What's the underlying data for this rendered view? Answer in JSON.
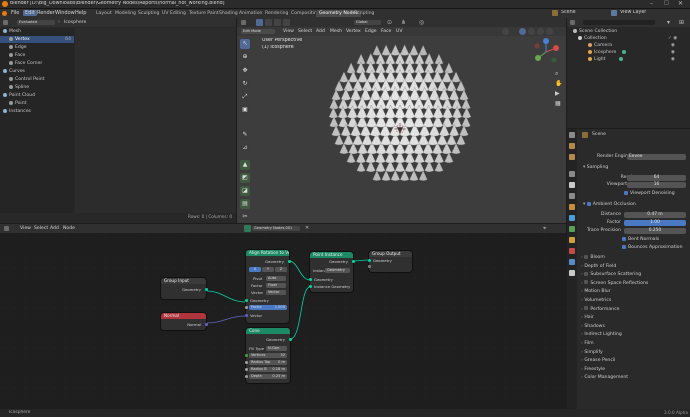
{
  "window": {
    "title": "Blender [D:\\Big_Downloads\\Blender\\Geometry Nodes\\Reports\\normal_not_working.blend]"
  },
  "menu": {
    "items": [
      "File",
      "Edit",
      "Render",
      "Window",
      "Help"
    ]
  },
  "workspaces": [
    "Layout",
    "Modeling",
    "Sculpting",
    "UV Editing",
    "Texture Paint",
    "Shading",
    "Animation",
    "Rendering",
    "Compositing",
    "Geometry Nodes",
    "Scripting"
  ],
  "active_workspace": "Geometry Nodes",
  "scene": {
    "name": "Scene",
    "view_layer": "View Layer"
  },
  "spreadsheet": {
    "mode": "Evaluated",
    "object": "Icosphere",
    "tree": [
      {
        "label": "Mesh",
        "count": "",
        "level": 0
      },
      {
        "label": "Vertex",
        "count": "64",
        "level": 1,
        "selected": true
      },
      {
        "label": "Edge",
        "count": "",
        "level": 1
      },
      {
        "label": "Face",
        "count": "",
        "level": 1
      },
      {
        "label": "Face Corner",
        "count": "",
        "level": 1
      },
      {
        "label": "Curves",
        "count": "",
        "level": 0
      },
      {
        "label": "Control Point",
        "count": "",
        "level": 1
      },
      {
        "label": "Spline",
        "count": "",
        "level": 1
      },
      {
        "label": "Point Cloud",
        "count": "",
        "level": 0
      },
      {
        "label": "Point",
        "count": "",
        "level": 1
      },
      {
        "label": "Instances",
        "count": "",
        "level": 0
      }
    ],
    "footer": "Rows: 0  |  Columns: 0"
  },
  "viewport": {
    "mode": "Edit Mode",
    "menu": [
      "View",
      "Select",
      "Add",
      "Mesh",
      "Vertex",
      "Edge",
      "Face",
      "UV"
    ],
    "orientation": "Global",
    "overlay_title": "User Perspective",
    "overlay_object": "(1) Icosphere"
  },
  "outliner": {
    "root": "Scene Collection",
    "items": [
      {
        "label": "Collection",
        "color": "#cfcfcf"
      },
      {
        "label": "Camera",
        "color": "#e0a060"
      },
      {
        "label": "Icosphere",
        "color": "#e8a24c"
      },
      {
        "label": "Light",
        "color": "#e8a24c"
      }
    ]
  },
  "properties": {
    "scene_label": "Scene",
    "render_engine_label": "Render Engine",
    "render_engine": "Eevee",
    "sampling": "Sampling",
    "render_label": "Render",
    "render_value": "64",
    "viewport_label": "Viewport",
    "viewport_value": "16",
    "viewport_denoising": "Viewport Denoising",
    "ao": "Ambient Occlusion",
    "distance_label": "Distance",
    "distance_value": "0.47 m",
    "factor_label": "Factor",
    "factor_value": "1.00",
    "trace_label": "Trace Precision",
    "trace_value": "0.250",
    "bent_normals": "Bent Normals",
    "bounces": "Bounces Approximation",
    "sections": [
      "Bloom",
      "Depth of Field",
      "Subsurface Scattering",
      "Screen Space Reflections",
      "Motion Blur",
      "Volumetrics",
      "Performance",
      "Hair",
      "Shadows",
      "Indirect Lighting",
      "Film",
      "Simplify",
      "Grease Pencil",
      "Freestyle",
      "Color Management"
    ]
  },
  "node_editor": {
    "menu": [
      "View",
      "Select",
      "Add",
      "Node"
    ],
    "tree_name": "Geometry Nodes.001",
    "nodes": {
      "group_input": {
        "title": "Group Input",
        "out": "Geometry"
      },
      "normal": {
        "title": "Normal",
        "out": "Normal"
      },
      "align": {
        "title": "Align Rotation to Vec",
        "out": "Geometry",
        "x": "X",
        "y": "Y",
        "z": "Z",
        "pivot_label": "Pivot",
        "pivot": "Auto",
        "factor_label": "Factor",
        "factor_mode": "Float",
        "vector_label": "Vector",
        "vector_mode": "Vector",
        "in_geometry": "Geometry",
        "factor": "Factor",
        "factor_value": "1.000",
        "in_vector": "Vector"
      },
      "point_instance": {
        "title": "Point Instance",
        "out": "Geometry",
        "instance_label": "Instan",
        "instance_value": "Geometry",
        "in_geometry": "Geometry",
        "in_instance": "Instance Geometry"
      },
      "group_output": {
        "title": "Group Output",
        "in": "Geometry"
      },
      "cone": {
        "title": "Cone",
        "out": "Geometry",
        "fill_label": "Fill Type",
        "fill_value": "N-Gon",
        "vertices_label": "Vertices",
        "vertices_value": "32",
        "radius_top_label": "Radius Top",
        "radius_top_value": "0 m",
        "radius_bottom_label": "Radius B",
        "radius_bottom_value": "0.18 m",
        "depth_label": "Depth",
        "depth_value": "0.25 m"
      }
    }
  },
  "status": {
    "left": "Icosphere",
    "version": "3.0.0 Alpha"
  },
  "colors": {
    "accent": "#4f6b95",
    "node_green": "#1d8a66",
    "node_red": "#b0343c",
    "node_output": "#3b3b3b",
    "geometry_socket": "#00d6a3",
    "vector_socket": "#6363c7",
    "float_socket": "#a1a1a1"
  }
}
